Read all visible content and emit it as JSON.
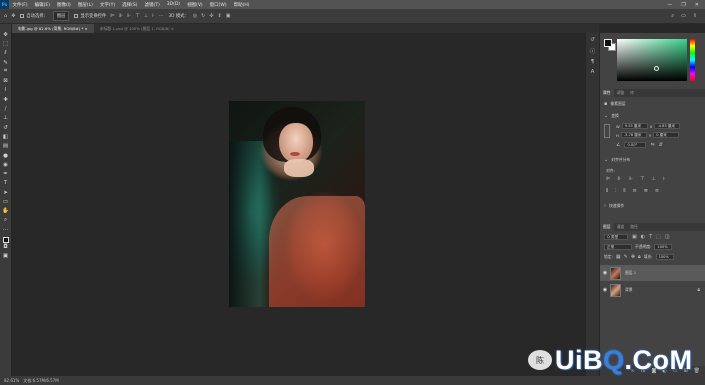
{
  "menubar": {
    "logo": "Ps",
    "items": [
      "文件(F)",
      "编辑(E)",
      "图像(I)",
      "图层(L)",
      "文字(Y)",
      "选择(S)",
      "滤镜(T)",
      "3D(D)",
      "视图(V)",
      "窗口(W)",
      "帮助(H)"
    ],
    "window_controls": [
      "—",
      "❐",
      "✕"
    ]
  },
  "optionsbar": {
    "move_icon": "move-icon",
    "auto_select_label": "自动选择：",
    "auto_select_value": "图层",
    "transform_label": "显示变换控件",
    "align_icons": [
      "align-left-icon",
      "align-center-icon",
      "align-right-icon",
      "align-top-icon",
      "align-middle-icon",
      "align-bottom-icon"
    ],
    "mode_3d_label": "3D 模式："
  },
  "tabs": [
    {
      "label": "电影.jpg @ 82.6% (背景, RGB/8#) *",
      "active": true
    },
    {
      "label": "未标题-1.psd @ 100% (图层 1, RGB/8)",
      "active": false
    }
  ],
  "tools": [
    "move-icon",
    "marquee-icon",
    "lasso-icon",
    "quick-select-icon",
    "crop-icon",
    "frame-icon",
    "eyedropper-icon",
    "healing-icon",
    "brush-icon",
    "stamp-icon",
    "history-brush-icon",
    "eraser-icon",
    "gradient-icon",
    "blur-icon",
    "dodge-icon",
    "pen-icon",
    "type-icon",
    "path-select-icon",
    "rectangle-icon",
    "hand-icon",
    "zoom-icon",
    "more-icon"
  ],
  "color_panel": {
    "fg_color": "#111111",
    "bg_color": "#ffffff",
    "hue_color": "#3ad28a"
  },
  "properties_panel": {
    "tabs": [
      "属性",
      "调整",
      "库"
    ],
    "doc_label": "像素图层",
    "transform_header": "变换",
    "w_label": "W",
    "w_value": "9.55 厘米",
    "x_label": "X",
    "x_value": "-4.83 厘米",
    "h_label": "H",
    "h_value": "-3.78 厘米",
    "y_label": "Y",
    "y_value": "0 厘米",
    "angle_value": "0.00°",
    "align_header": "对齐并分布",
    "align_sub": "对齐:",
    "quick_actions": "快速操作"
  },
  "layers_panel": {
    "tabs": [
      "图层",
      "通道",
      "路径"
    ],
    "kind_label": "Q 类型",
    "blend_mode": "正常",
    "opacity_label": "不透明度:",
    "opacity_value": "100%",
    "lock_label": "锁定:",
    "fill_label": "填充:",
    "fill_value": "100%",
    "layers": [
      {
        "name": "图层 1",
        "selected": true
      },
      {
        "name": "背景",
        "selected": false
      }
    ]
  },
  "statusbar": {
    "zoom": "82.61%",
    "doc_info": "文档:6.57M/6.57M"
  },
  "watermark": {
    "bubble_text": "陈",
    "brand_prefix": "UiB",
    "brand_q": "Q",
    "brand_suffix": ".CoM"
  }
}
